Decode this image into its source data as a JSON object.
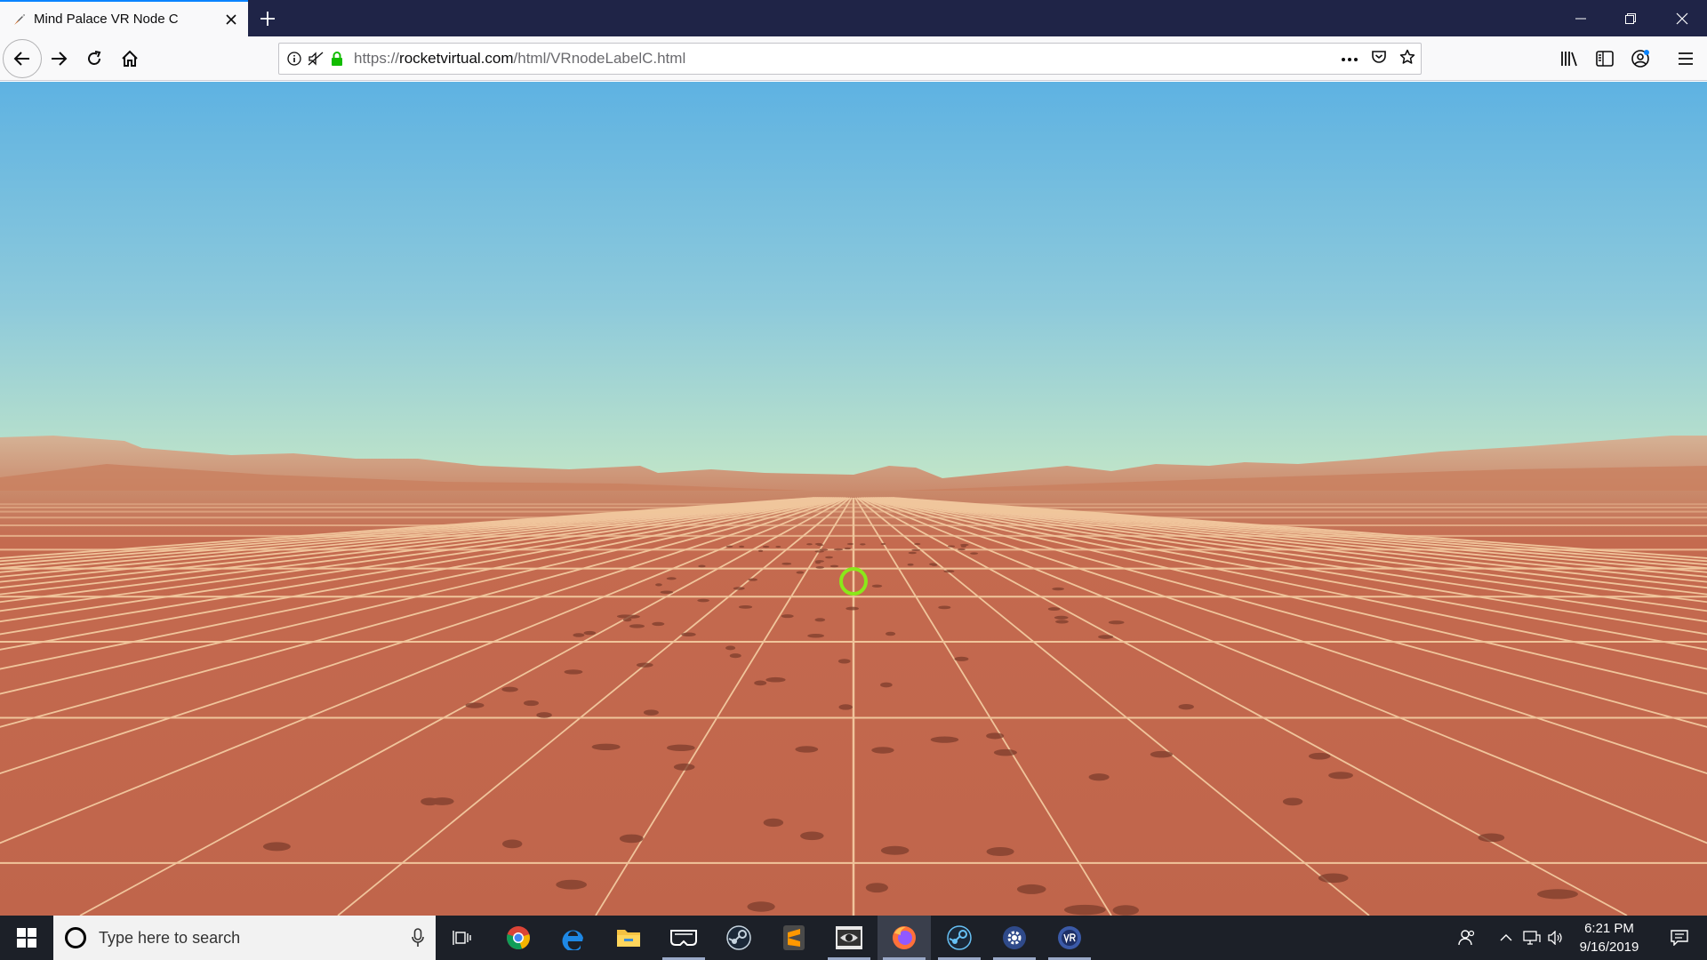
{
  "browser": {
    "tab_title": "Mind Palace VR Node C",
    "url_scheme": "https://",
    "url_host": "rocketvirtual.com",
    "url_path": "/html/VRnodeLabelC.html"
  },
  "scene": {
    "description_colors": {
      "sky_top": "#62b3e0",
      "sky_horizon": "#b8e0c8",
      "ground": "#c2674d",
      "grid_lines": "#f3caa0",
      "reticle": "#8ae81a"
    }
  },
  "taskbar": {
    "search_placeholder": "Type here to search",
    "time": "6:21 PM",
    "date": "9/16/2019",
    "apps": [
      "task-view",
      "chrome",
      "edge",
      "file-explorer",
      "vr-headset",
      "steam",
      "sublime-text",
      "eye-app",
      "firefox",
      "steam-vr",
      "settings-app",
      "vr-app"
    ]
  }
}
